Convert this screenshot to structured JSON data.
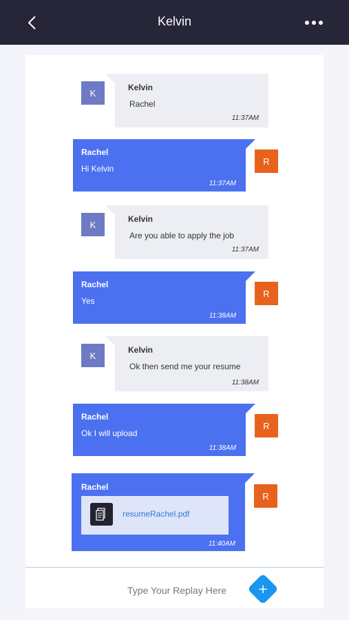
{
  "header": {
    "title": "Kelvin",
    "back_icon": "chevron-left-icon",
    "more_icon": "more-horizontal-icon"
  },
  "messages": [
    {
      "direction": "in",
      "avatar": "K",
      "sender": "Kelvin",
      "text": "Rachel",
      "time": "11:37AM"
    },
    {
      "direction": "out",
      "avatar": "R",
      "sender": "Rachel",
      "text": "Hi Kelvin",
      "time": "11:37AM"
    },
    {
      "direction": "in",
      "avatar": "K",
      "sender": "Kelvin",
      "text": "Are you able to apply the job",
      "time": "11:37AM"
    },
    {
      "direction": "out",
      "avatar": "R",
      "sender": "Rachel",
      "text": "Yes",
      "time": "11:38AM"
    },
    {
      "direction": "in",
      "avatar": "K",
      "sender": "Kelvin",
      "text": "Ok then send me your resume",
      "time": "11:38AM"
    },
    {
      "direction": "out",
      "avatar": "R",
      "sender": "Rachel",
      "text": "Ok I will upload",
      "time": "11:38AM"
    },
    {
      "direction": "out",
      "avatar": "R",
      "sender": "Rachel",
      "attachment": "resumeRachel.pdf",
      "time": "11:40AM"
    }
  ],
  "composer": {
    "placeholder": "Type Your Replay Here",
    "value": "",
    "send_label": "+"
  },
  "colors": {
    "topbar": "#262638",
    "incoming_bubble": "#eceef3",
    "outgoing_bubble": "#4b71f0",
    "avatar_k": "#6d7bc4",
    "avatar_r": "#e8621c",
    "send_button": "#1a95f0"
  }
}
